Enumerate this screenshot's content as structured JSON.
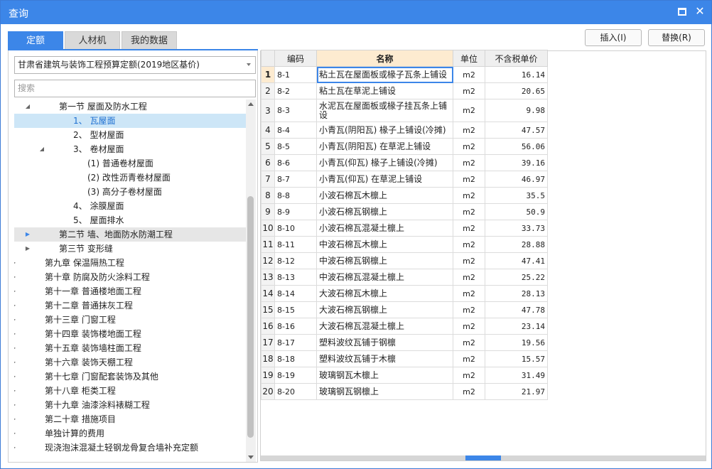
{
  "window": {
    "title": "查询"
  },
  "tabs": [
    "定额",
    "人材机",
    "我的数据"
  ],
  "actions": {
    "insert": "插入(I)",
    "replace": "替换(R)"
  },
  "library": {
    "selected": "甘肃省建筑与装饰工程预算定额(2019地区基价)"
  },
  "search": {
    "placeholder": "搜索"
  },
  "tree": [
    {
      "label": "第一节 屋面及防水工程",
      "level": 2,
      "expander": "expanded"
    },
    {
      "label": "1、 瓦屋面",
      "level": 3,
      "expander": "none",
      "state": "selected"
    },
    {
      "label": "2、 型材屋面",
      "level": 3,
      "expander": "none"
    },
    {
      "label": "3、 卷材屋面",
      "level": 3,
      "expander": "expanded"
    },
    {
      "label": "(1) 普通卷材屋面",
      "level": 4,
      "expander": "none"
    },
    {
      "label": "(2) 改性沥青卷材屋面",
      "level": 4,
      "expander": "none"
    },
    {
      "label": "(3) 高分子卷材屋面",
      "level": 4,
      "expander": "none"
    },
    {
      "label": "4、 涂膜屋面",
      "level": 3,
      "expander": "none"
    },
    {
      "label": "5、 屋面排水",
      "level": 3,
      "expander": "none"
    },
    {
      "label": "第二节 墙、地面防水防潮工程",
      "level": 2,
      "expander": "collapsed",
      "state": "hover"
    },
    {
      "label": "第三节 变形缝",
      "level": 2,
      "expander": "collapsed"
    },
    {
      "label": "第九章 保温隔热工程",
      "level": 1,
      "expander": "collapsed"
    },
    {
      "label": "第十章 防腐及防火涂料工程",
      "level": 1,
      "expander": "collapsed"
    },
    {
      "label": "第十一章 普通楼地面工程",
      "level": 1,
      "expander": "collapsed"
    },
    {
      "label": "第十二章 普通抹灰工程",
      "level": 1,
      "expander": "collapsed"
    },
    {
      "label": "第十三章 门窗工程",
      "level": 1,
      "expander": "collapsed"
    },
    {
      "label": "第十四章 装饰楼地面工程",
      "level": 1,
      "expander": "collapsed"
    },
    {
      "label": "第十五章 装饰墙柱面工程",
      "level": 1,
      "expander": "collapsed"
    },
    {
      "label": "第十六章 装饰天棚工程",
      "level": 1,
      "expander": "collapsed"
    },
    {
      "label": "第十七章 门窗配套装饰及其他",
      "level": 1,
      "expander": "collapsed"
    },
    {
      "label": "第十八章 柜类工程",
      "level": 1,
      "expander": "collapsed"
    },
    {
      "label": "第十九章 油漆涂料裱糊工程",
      "level": 1,
      "expander": "collapsed"
    },
    {
      "label": "第二十章 措施项目",
      "level": 1,
      "expander": "collapsed"
    },
    {
      "label": "单独计算的费用",
      "level": 1,
      "expander": "collapsed"
    },
    {
      "label": "现浇泡沫混凝土轻钢龙骨复合墙补充定额",
      "level": 1,
      "expander": "collapsed"
    }
  ],
  "table": {
    "columns": [
      "编码",
      "名称",
      "单位",
      "不含税单价"
    ],
    "rows": [
      {
        "n": "1",
        "code": "8-1",
        "name": "粘土瓦在屋面板或椽子瓦条上铺设",
        "unit": "m2",
        "price": "16.14"
      },
      {
        "n": "2",
        "code": "8-2",
        "name": "粘土瓦在草泥上铺设",
        "unit": "m2",
        "price": "20.65"
      },
      {
        "n": "3",
        "code": "8-3",
        "name": "水泥瓦在屋面板或椽子挂瓦条上铺设",
        "unit": "m2",
        "price": "9.98"
      },
      {
        "n": "4",
        "code": "8-4",
        "name": "小青瓦(阴阳瓦) 椽子上铺设(冷摊)",
        "unit": "m2",
        "price": "47.57"
      },
      {
        "n": "5",
        "code": "8-5",
        "name": "小青瓦(阴阳瓦) 在草泥上铺设",
        "unit": "m2",
        "price": "56.06"
      },
      {
        "n": "6",
        "code": "8-6",
        "name": "小青瓦(仰瓦) 椽子上铺设(冷摊)",
        "unit": "m2",
        "price": "39.16"
      },
      {
        "n": "7",
        "code": "8-7",
        "name": "小青瓦(仰瓦) 在草泥上铺设",
        "unit": "m2",
        "price": "46.97"
      },
      {
        "n": "8",
        "code": "8-8",
        "name": "小波石棉瓦木檩上",
        "unit": "m2",
        "price": "35.5"
      },
      {
        "n": "9",
        "code": "8-9",
        "name": "小波石棉瓦钢檩上",
        "unit": "m2",
        "price": "50.9"
      },
      {
        "n": "10",
        "code": "8-10",
        "name": "小波石棉瓦混凝土檩上",
        "unit": "m2",
        "price": "33.73"
      },
      {
        "n": "11",
        "code": "8-11",
        "name": "中波石棉瓦木檩上",
        "unit": "m2",
        "price": "28.88"
      },
      {
        "n": "12",
        "code": "8-12",
        "name": "中波石棉瓦钢檩上",
        "unit": "m2",
        "price": "47.41"
      },
      {
        "n": "13",
        "code": "8-13",
        "name": "中波石棉瓦混凝土檩上",
        "unit": "m2",
        "price": "25.22"
      },
      {
        "n": "14",
        "code": "8-14",
        "name": "大波石棉瓦木檩上",
        "unit": "m2",
        "price": "28.13"
      },
      {
        "n": "15",
        "code": "8-15",
        "name": "大波石棉瓦钢檩上",
        "unit": "m2",
        "price": "47.78"
      },
      {
        "n": "16",
        "code": "8-16",
        "name": "大波石棉瓦混凝土檩上",
        "unit": "m2",
        "price": "23.14"
      },
      {
        "n": "17",
        "code": "8-17",
        "name": "塑料波纹瓦铺于钢檩",
        "unit": "m2",
        "price": "19.56"
      },
      {
        "n": "18",
        "code": "8-18",
        "name": "塑料波纹瓦铺于木檩",
        "unit": "m2",
        "price": "15.57"
      },
      {
        "n": "19",
        "code": "8-19",
        "name": "玻璃钢瓦木檩上",
        "unit": "m2",
        "price": "31.49"
      },
      {
        "n": "20",
        "code": "8-20",
        "name": "玻璃钢瓦钢檩上",
        "unit": "m2",
        "price": "21.97"
      }
    ]
  },
  "colors": {
    "accent": "#3c86e8",
    "header_highlight": "#fdebd0",
    "tree_selected": "#cde6f7"
  }
}
